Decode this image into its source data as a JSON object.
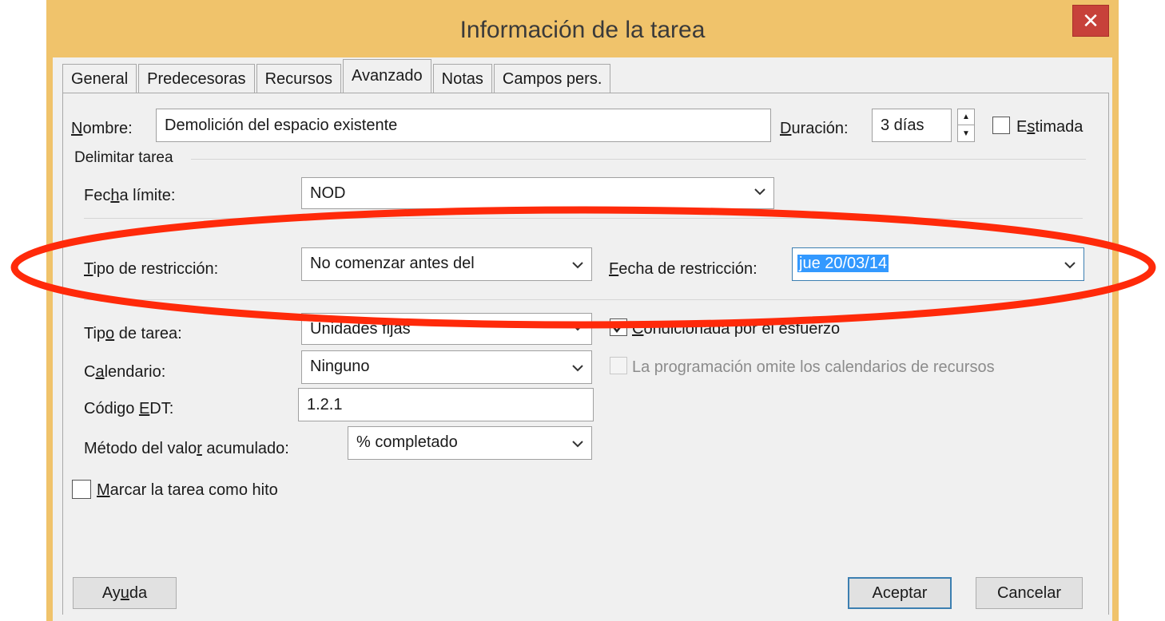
{
  "window": {
    "title": "Información de la tarea",
    "close_glyph": "✕"
  },
  "tabs": [
    {
      "label": "General",
      "active": false
    },
    {
      "label": "Predecesoras",
      "active": false
    },
    {
      "label": "Recursos",
      "active": false
    },
    {
      "label": "Avanzado",
      "active": true
    },
    {
      "label": "Notas",
      "active": false
    },
    {
      "label": "Campos pers.",
      "active": false
    }
  ],
  "nombre": {
    "label_accel": "N",
    "label_rest": "ombre:",
    "value": "Demolición del espacio existente"
  },
  "duracion": {
    "label_accel": "D",
    "label_rest": "uración:",
    "value": "3 días"
  },
  "estimada": {
    "label_pre": "E",
    "label_accel": "s",
    "label_rest": "timada",
    "checked": false
  },
  "delimitar": {
    "group_label": "Delimitar tarea",
    "fecha_limite": {
      "label_pre": "Fec",
      "label_accel": "h",
      "label_rest": "a límite:",
      "value": "NOD"
    },
    "tipo_restriccion": {
      "label_accel": "T",
      "label_rest": "ipo de restricción:",
      "value": "No comenzar antes del"
    },
    "fecha_restriccion": {
      "label_accel": "F",
      "label_rest": "echa de restricción:",
      "value": "jue 20/03/14"
    }
  },
  "tipo_tarea": {
    "label_pre": "Tip",
    "label_accel": "o",
    "label_rest": " de tarea:",
    "value": "Unidades fijas"
  },
  "condicionada": {
    "label_accel": "C",
    "label_rest": "ondicionada por el esfuerzo",
    "checked": true
  },
  "calendario": {
    "label_pre": "C",
    "label_accel": "a",
    "label_rest": "lendario:",
    "value": "Ninguno"
  },
  "omite_calendarios": {
    "label_pre": "La pro",
    "label_accel": "g",
    "label_rest": "ramación omite los calendarios de recursos",
    "checked": false,
    "enabled": false
  },
  "codigo_edt": {
    "label_pre": "Código ",
    "label_accel": "E",
    "label_rest": "DT:",
    "value": "1.2.1"
  },
  "metodo_valor": {
    "label_pre": "Método del valo",
    "label_accel": "r",
    "label_rest": " acumulado:",
    "value": "% completado"
  },
  "hito": {
    "label_accel": "M",
    "label_rest": "arcar la tarea como hito",
    "checked": false
  },
  "buttons": {
    "ayuda": {
      "pre": "Ay",
      "accel": "u",
      "rest": "da"
    },
    "aceptar": "Aceptar",
    "cancelar": "Cancelar"
  },
  "colors": {
    "title_bar": "#f0c36b",
    "close": "#c7413a",
    "annotation": "#ff2a0a",
    "selection": "#3399ff"
  },
  "icons": {
    "close": "close-icon",
    "dropdown": "chevron-down-icon",
    "spin_up": "spin-up-icon",
    "spin_down": "spin-down-icon",
    "check": "checkmark-icon"
  }
}
